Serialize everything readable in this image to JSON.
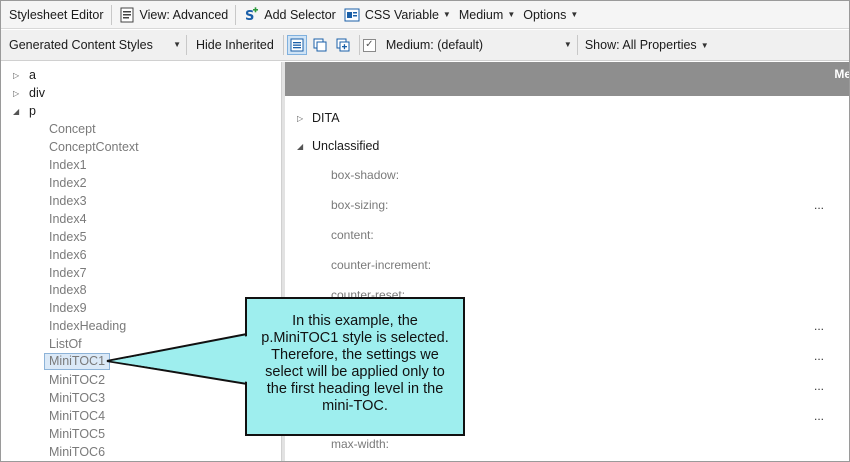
{
  "toolbar1": {
    "title": "Stylesheet Editor",
    "view": "View: Advanced",
    "add_selector": "Add Selector",
    "css_variable": "CSS Variable",
    "medium": "Medium",
    "options": "Options"
  },
  "toolbar2": {
    "style_filter": "Generated Content Styles",
    "hide_inherited": "Hide Inherited",
    "medium_select": "Medium: (default)",
    "show": "Show: All Properties"
  },
  "tree": {
    "nodes": [
      "a",
      "div",
      "p"
    ],
    "children": [
      "Concept",
      "ConceptContext",
      "Index1",
      "Index2",
      "Index3",
      "Index4",
      "Index5",
      "Index6",
      "Index7",
      "Index8",
      "Index9",
      "IndexHeading",
      "ListOf",
      "MiniTOC1",
      "MiniTOC2",
      "MiniTOC3",
      "MiniTOC4",
      "MiniTOC5",
      "MiniTOC6"
    ]
  },
  "grid": {
    "header": "Me",
    "categories": [
      "DITA",
      "Unclassified"
    ],
    "properties": [
      "box-shadow:",
      "box-sizing:",
      "content:",
      "counter-increment:",
      "counter-reset:",
      "max-width:"
    ],
    "ellipsis": "..."
  },
  "callout": {
    "text": "In this example, the p.MiniTOC1 style is selected. Therefore, the settings we select will be applied only to the first heading level in the mini-TOC."
  },
  "colors": {
    "callout_bg": "#9eeeee",
    "header_bg": "#8e8e8e",
    "selection_bg": "#dbe9f7"
  }
}
